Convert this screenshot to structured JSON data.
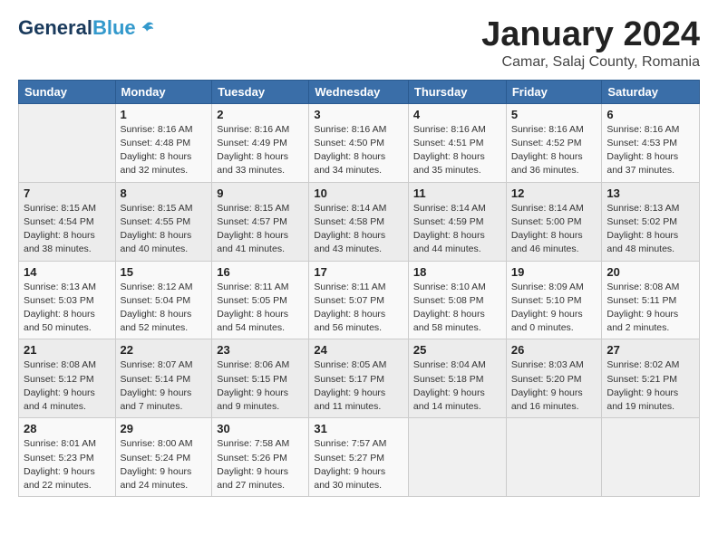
{
  "header": {
    "logo_general": "General",
    "logo_blue": "Blue",
    "title": "January 2024",
    "location": "Camar, Salaj County, Romania"
  },
  "columns": [
    "Sunday",
    "Monday",
    "Tuesday",
    "Wednesday",
    "Thursday",
    "Friday",
    "Saturday"
  ],
  "weeks": [
    [
      {
        "day": "",
        "info": ""
      },
      {
        "day": "1",
        "info": "Sunrise: 8:16 AM\nSunset: 4:48 PM\nDaylight: 8 hours\nand 32 minutes."
      },
      {
        "day": "2",
        "info": "Sunrise: 8:16 AM\nSunset: 4:49 PM\nDaylight: 8 hours\nand 33 minutes."
      },
      {
        "day": "3",
        "info": "Sunrise: 8:16 AM\nSunset: 4:50 PM\nDaylight: 8 hours\nand 34 minutes."
      },
      {
        "day": "4",
        "info": "Sunrise: 8:16 AM\nSunset: 4:51 PM\nDaylight: 8 hours\nand 35 minutes."
      },
      {
        "day": "5",
        "info": "Sunrise: 8:16 AM\nSunset: 4:52 PM\nDaylight: 8 hours\nand 36 minutes."
      },
      {
        "day": "6",
        "info": "Sunrise: 8:16 AM\nSunset: 4:53 PM\nDaylight: 8 hours\nand 37 minutes."
      }
    ],
    [
      {
        "day": "7",
        "info": "Sunrise: 8:15 AM\nSunset: 4:54 PM\nDaylight: 8 hours\nand 38 minutes."
      },
      {
        "day": "8",
        "info": "Sunrise: 8:15 AM\nSunset: 4:55 PM\nDaylight: 8 hours\nand 40 minutes."
      },
      {
        "day": "9",
        "info": "Sunrise: 8:15 AM\nSunset: 4:57 PM\nDaylight: 8 hours\nand 41 minutes."
      },
      {
        "day": "10",
        "info": "Sunrise: 8:14 AM\nSunset: 4:58 PM\nDaylight: 8 hours\nand 43 minutes."
      },
      {
        "day": "11",
        "info": "Sunrise: 8:14 AM\nSunset: 4:59 PM\nDaylight: 8 hours\nand 44 minutes."
      },
      {
        "day": "12",
        "info": "Sunrise: 8:14 AM\nSunset: 5:00 PM\nDaylight: 8 hours\nand 46 minutes."
      },
      {
        "day": "13",
        "info": "Sunrise: 8:13 AM\nSunset: 5:02 PM\nDaylight: 8 hours\nand 48 minutes."
      }
    ],
    [
      {
        "day": "14",
        "info": "Sunrise: 8:13 AM\nSunset: 5:03 PM\nDaylight: 8 hours\nand 50 minutes."
      },
      {
        "day": "15",
        "info": "Sunrise: 8:12 AM\nSunset: 5:04 PM\nDaylight: 8 hours\nand 52 minutes."
      },
      {
        "day": "16",
        "info": "Sunrise: 8:11 AM\nSunset: 5:05 PM\nDaylight: 8 hours\nand 54 minutes."
      },
      {
        "day": "17",
        "info": "Sunrise: 8:11 AM\nSunset: 5:07 PM\nDaylight: 8 hours\nand 56 minutes."
      },
      {
        "day": "18",
        "info": "Sunrise: 8:10 AM\nSunset: 5:08 PM\nDaylight: 8 hours\nand 58 minutes."
      },
      {
        "day": "19",
        "info": "Sunrise: 8:09 AM\nSunset: 5:10 PM\nDaylight: 9 hours\nand 0 minutes."
      },
      {
        "day": "20",
        "info": "Sunrise: 8:08 AM\nSunset: 5:11 PM\nDaylight: 9 hours\nand 2 minutes."
      }
    ],
    [
      {
        "day": "21",
        "info": "Sunrise: 8:08 AM\nSunset: 5:12 PM\nDaylight: 9 hours\nand 4 minutes."
      },
      {
        "day": "22",
        "info": "Sunrise: 8:07 AM\nSunset: 5:14 PM\nDaylight: 9 hours\nand 7 minutes."
      },
      {
        "day": "23",
        "info": "Sunrise: 8:06 AM\nSunset: 5:15 PM\nDaylight: 9 hours\nand 9 minutes."
      },
      {
        "day": "24",
        "info": "Sunrise: 8:05 AM\nSunset: 5:17 PM\nDaylight: 9 hours\nand 11 minutes."
      },
      {
        "day": "25",
        "info": "Sunrise: 8:04 AM\nSunset: 5:18 PM\nDaylight: 9 hours\nand 14 minutes."
      },
      {
        "day": "26",
        "info": "Sunrise: 8:03 AM\nSunset: 5:20 PM\nDaylight: 9 hours\nand 16 minutes."
      },
      {
        "day": "27",
        "info": "Sunrise: 8:02 AM\nSunset: 5:21 PM\nDaylight: 9 hours\nand 19 minutes."
      }
    ],
    [
      {
        "day": "28",
        "info": "Sunrise: 8:01 AM\nSunset: 5:23 PM\nDaylight: 9 hours\nand 22 minutes."
      },
      {
        "day": "29",
        "info": "Sunrise: 8:00 AM\nSunset: 5:24 PM\nDaylight: 9 hours\nand 24 minutes."
      },
      {
        "day": "30",
        "info": "Sunrise: 7:58 AM\nSunset: 5:26 PM\nDaylight: 9 hours\nand 27 minutes."
      },
      {
        "day": "31",
        "info": "Sunrise: 7:57 AM\nSunset: 5:27 PM\nDaylight: 9 hours\nand 30 minutes."
      },
      {
        "day": "",
        "info": ""
      },
      {
        "day": "",
        "info": ""
      },
      {
        "day": "",
        "info": ""
      }
    ]
  ]
}
